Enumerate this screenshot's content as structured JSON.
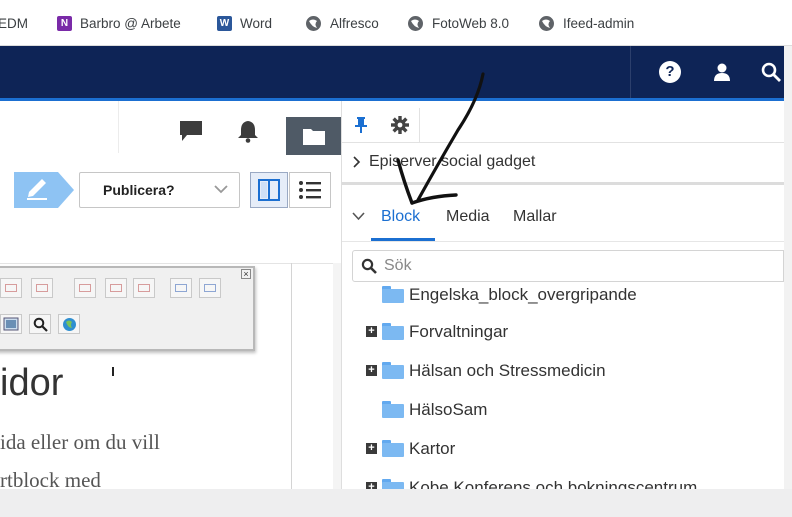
{
  "bookmarks": [
    {
      "label": "EDM",
      "icon": "edm-icon"
    },
    {
      "label": "Barbro @ Arbete",
      "icon": "onenote-icon"
    },
    {
      "label": "Word",
      "icon": "word-icon"
    },
    {
      "label": "Alfresco",
      "icon": "globe-icon"
    },
    {
      "label": "FotoWeb 8.0",
      "icon": "globe-icon"
    },
    {
      "label": "Ifeed-admin",
      "icon": "globe-icon"
    }
  ],
  "header": {
    "help_glyph": "?",
    "bg_color": "#0e2456",
    "accent_color": "#1b6fd1"
  },
  "editor": {
    "publish_label": "Publicera?",
    "heading": "idor",
    "body_line_1": "ida eller om du vill",
    "body_line_2": "rtblock med"
  },
  "asset_panel": {
    "gadget_label": "Episerver social gadget",
    "tabs": [
      {
        "label": "Block",
        "active": true
      },
      {
        "label": "Media",
        "active": false
      },
      {
        "label": "Mallar",
        "active": false
      }
    ],
    "search_placeholder": "Sök",
    "tree": [
      {
        "label": "Engelska_block_overgripande",
        "expandable": false
      },
      {
        "label": "Forvaltningar",
        "expandable": true
      },
      {
        "label": "Hälsan och Stressmedicin",
        "expandable": true
      },
      {
        "label": "HälsoSam",
        "expandable": false
      },
      {
        "label": "Kartor",
        "expandable": true
      },
      {
        "label": "Kobe Konferens och bokningscentrum",
        "expandable": true
      }
    ]
  }
}
